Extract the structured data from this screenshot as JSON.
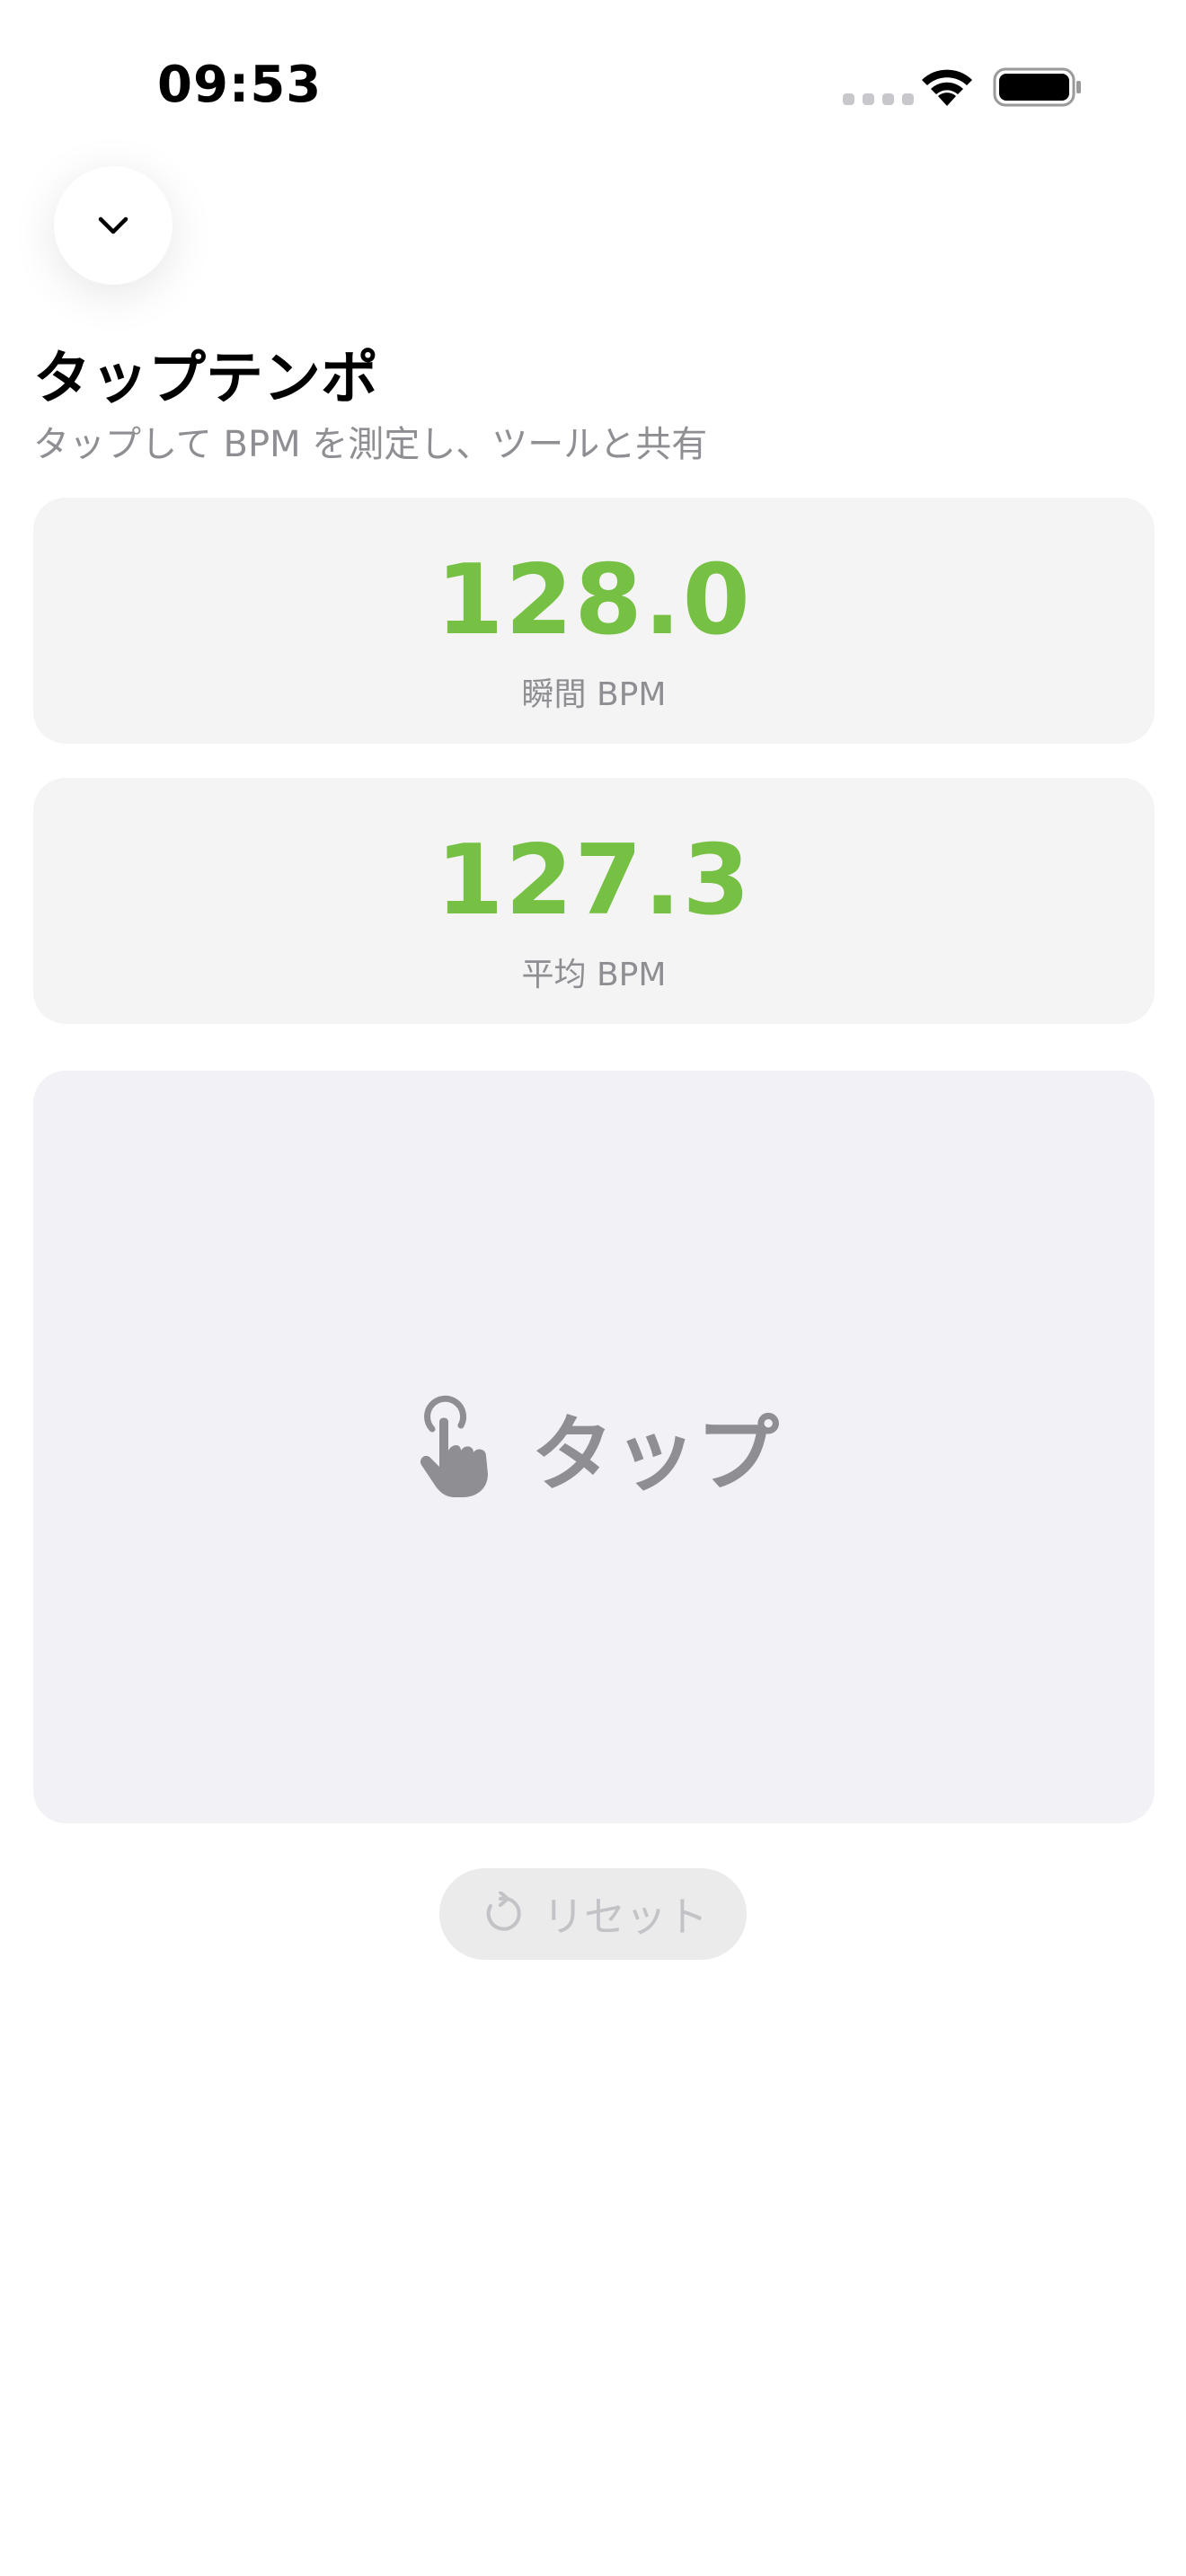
{
  "status_bar": {
    "time": "09:53"
  },
  "header": {
    "title": "タップテンポ",
    "subtitle": "タップして BPM を測定し、ツールと共有"
  },
  "instant": {
    "value": "128.0",
    "label": "瞬間 BPM"
  },
  "average": {
    "value": "127.3",
    "label": "平均 BPM"
  },
  "tap_pad": {
    "label": "タップ",
    "icon": "hand-tap-icon"
  },
  "reset": {
    "label": "リセット",
    "icon": "reset-arrow-icon"
  },
  "colors": {
    "accent": "#76c043",
    "secondary_text": "#8e8e93",
    "card_bg": "#f4f4f4",
    "tap_pad_bg": "#f2f2f6"
  }
}
